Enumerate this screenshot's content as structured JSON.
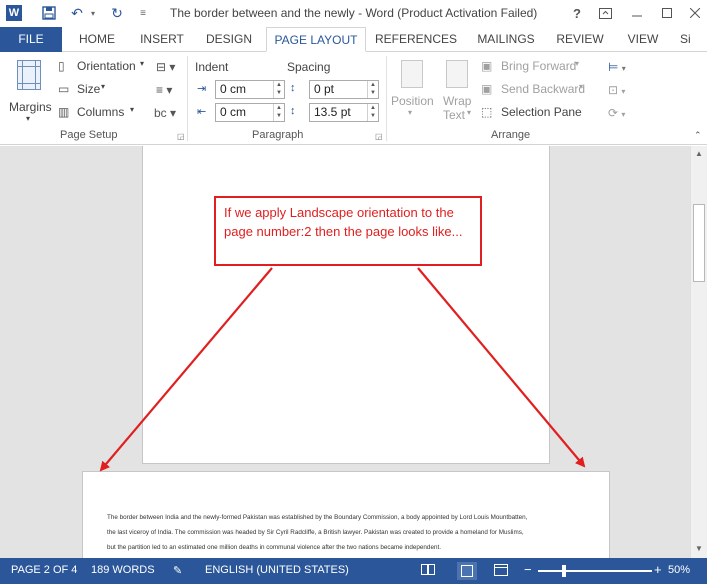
{
  "window": {
    "title": "The border between and the newly - Word (Product Activation Failed)",
    "help_icon": "?",
    "controls": [
      "restore-icon",
      "minimize-icon",
      "maximize-icon"
    ]
  },
  "tabs": [
    {
      "label": "FILE"
    },
    {
      "label": "HOME"
    },
    {
      "label": "INSERT"
    },
    {
      "label": "DESIGN"
    },
    {
      "label": "PAGE LAYOUT"
    },
    {
      "label": "REFERENCES"
    },
    {
      "label": "MAILINGS"
    },
    {
      "label": "REVIEW"
    },
    {
      "label": "VIEW"
    },
    {
      "label": "Si"
    }
  ],
  "ribbon": {
    "page_setup": {
      "margins": "Margins",
      "orientation": "Orientation",
      "size": "Size",
      "columns": "Columns",
      "group": "Page Setup"
    },
    "paragraph": {
      "indent": "Indent",
      "spacing": "Spacing",
      "indent_left": "0 cm",
      "indent_right": "0 cm",
      "spacing_before": "0 pt",
      "spacing_after": "13.5 pt",
      "group": "Paragraph"
    },
    "arrange": {
      "position": "Position",
      "wrap_text_1": "Wrap",
      "wrap_text_2": "Text",
      "bring_forward": "Bring Forward",
      "send_backward": "Send Backward",
      "selection_pane": "Selection Pane",
      "group": "Arrange"
    }
  },
  "document": {
    "callout": "If we apply Landscape orientation to the page number:2 then the page looks like...",
    "paragraph_lines": [
      "The border between India and the newly-formed Pakistan was established by the Boundary Commission, a body appointed by Lord Louis Mountbatten,",
      "the last viceroy of India. The commission was headed by Sir Cyril Radcliffe, a British lawyer. Pakistan was created to provide a homeland for Muslims,",
      "but the partition led to an estimated one million deaths in communal violence after the two nations became independent."
    ]
  },
  "status": {
    "page": "PAGE 2 OF 4",
    "words": "189 WORDS",
    "language": "ENGLISH (UNITED STATES)",
    "zoom": "50%"
  },
  "colors": {
    "accent": "#2b579a",
    "callout": "#e02020"
  }
}
